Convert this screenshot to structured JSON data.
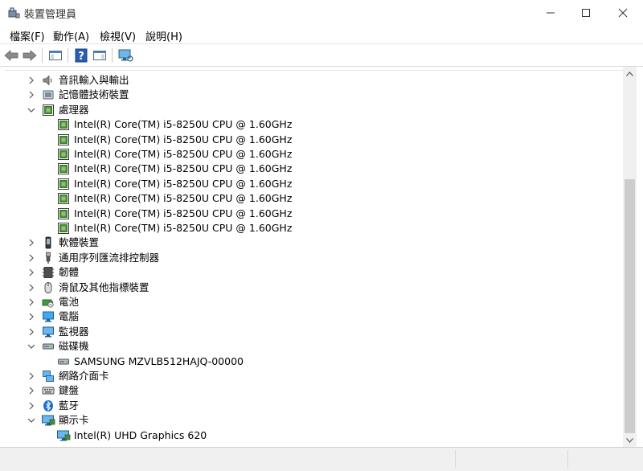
{
  "window": {
    "title": "裝置管理員",
    "controls": {
      "minimize": "—",
      "maximize": "☐",
      "close": "✕"
    }
  },
  "menu": [
    {
      "label": "檔案(F)"
    },
    {
      "label": "動作(A)"
    },
    {
      "label": "檢視(V)"
    },
    {
      "label": "說明(H)"
    }
  ],
  "toolbar": {
    "buttons": [
      "back-arrow-icon",
      "forward-arrow-icon",
      "show-hide-console-tree-icon",
      "help-icon",
      "action-pane-icon",
      "monitor-scan-icon"
    ]
  },
  "tree": [
    {
      "label": "音訊輸入與輸出",
      "icon": "speaker-icon",
      "state": "collapsed"
    },
    {
      "label": "記憶體技術裝置",
      "icon": "memory-device-icon",
      "state": "collapsed"
    },
    {
      "label": "處理器",
      "icon": "processor-icon",
      "state": "expanded"
    },
    {
      "label": "Intel(R) Core(TM) i5-8250U CPU @ 1.60GHz",
      "icon": "processor-icon",
      "state": "child"
    },
    {
      "label": "Intel(R) Core(TM) i5-8250U CPU @ 1.60GHz",
      "icon": "processor-icon",
      "state": "child"
    },
    {
      "label": "Intel(R) Core(TM) i5-8250U CPU @ 1.60GHz",
      "icon": "processor-icon",
      "state": "child"
    },
    {
      "label": "Intel(R) Core(TM) i5-8250U CPU @ 1.60GHz",
      "icon": "processor-icon",
      "state": "child"
    },
    {
      "label": "Intel(R) Core(TM) i5-8250U CPU @ 1.60GHz",
      "icon": "processor-icon",
      "state": "child"
    },
    {
      "label": "Intel(R) Core(TM) i5-8250U CPU @ 1.60GHz",
      "icon": "processor-icon",
      "state": "child"
    },
    {
      "label": "Intel(R) Core(TM) i5-8250U CPU @ 1.60GHz",
      "icon": "processor-icon",
      "state": "child"
    },
    {
      "label": "Intel(R) Core(TM) i5-8250U CPU @ 1.60GHz",
      "icon": "processor-icon",
      "state": "child"
    },
    {
      "label": "軟體裝置",
      "icon": "software-device-icon",
      "state": "collapsed"
    },
    {
      "label": "通用序列匯流排控制器",
      "icon": "usb-icon",
      "state": "collapsed"
    },
    {
      "label": "韌體",
      "icon": "firmware-icon",
      "state": "collapsed"
    },
    {
      "label": "滑鼠及其他指標裝置",
      "icon": "mouse-icon",
      "state": "collapsed"
    },
    {
      "label": "電池",
      "icon": "battery-icon",
      "state": "collapsed"
    },
    {
      "label": "電腦",
      "icon": "computer-icon",
      "state": "collapsed"
    },
    {
      "label": "監視器",
      "icon": "monitor-icon",
      "state": "collapsed"
    },
    {
      "label": "磁碟機",
      "icon": "disk-drive-icon",
      "state": "expanded"
    },
    {
      "label": "SAMSUNG MZVLB512HAJQ-00000",
      "icon": "disk-drive-icon",
      "state": "child"
    },
    {
      "label": "網路介面卡",
      "icon": "network-adapter-icon",
      "state": "collapsed"
    },
    {
      "label": "鍵盤",
      "icon": "keyboard-icon",
      "state": "collapsed"
    },
    {
      "label": "藍牙",
      "icon": "bluetooth-icon",
      "state": "collapsed"
    },
    {
      "label": "顯示卡",
      "icon": "display-adapter-icon",
      "state": "expanded"
    },
    {
      "label": "Intel(R) UHD Graphics 620",
      "icon": "display-adapter-icon",
      "state": "child"
    }
  ],
  "colors": {
    "accent": "#0078d7",
    "processor_green": "#2e7d32",
    "text": "#000000"
  }
}
